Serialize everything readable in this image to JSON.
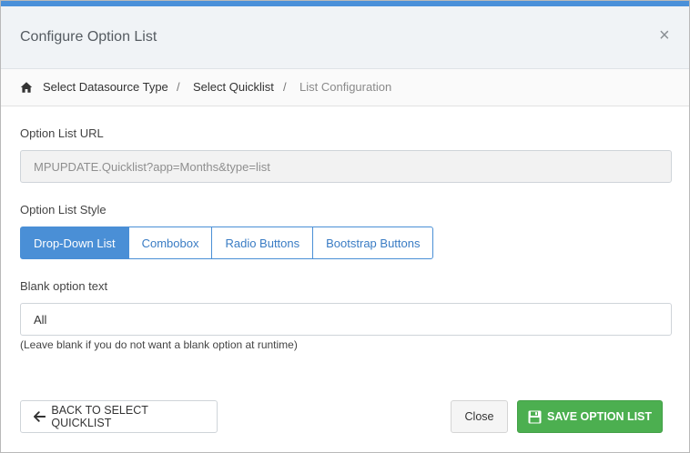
{
  "modal": {
    "title": "Configure Option List",
    "close_glyph": "×"
  },
  "breadcrumb": {
    "home_icon": "home-icon",
    "items": [
      "Select Datasource Type",
      "Select Quicklist",
      "List Configuration"
    ],
    "separator": "/"
  },
  "option_list_url": {
    "label": "Option List URL",
    "value": "MPUPDATE.Quicklist?app=Months&type=list"
  },
  "option_list_style": {
    "label": "Option List Style",
    "options": [
      "Drop-Down List",
      "Combobox",
      "Radio Buttons",
      "Bootstrap Buttons"
    ],
    "selected": "Drop-Down List"
  },
  "blank_option": {
    "label": "Blank option text",
    "value": "All",
    "help": "(Leave blank if you do not want a blank option at runtime)"
  },
  "footer": {
    "back_label": "BACK TO SELECT QUICKLIST",
    "close_label": "Close",
    "save_label": "SAVE OPTION LIST"
  },
  "colors": {
    "accent": "#4a90d9",
    "primary": "#4a8fd6",
    "success": "#4caf50"
  }
}
